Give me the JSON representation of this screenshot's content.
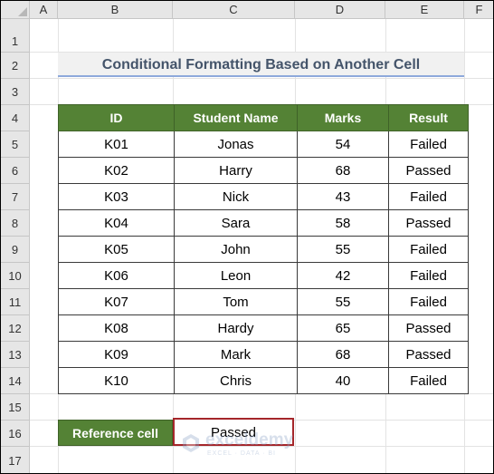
{
  "columns": [
    "A",
    "B",
    "C",
    "D",
    "E",
    "F"
  ],
  "rows": [
    "1",
    "2",
    "3",
    "4",
    "5",
    "6",
    "7",
    "8",
    "9",
    "10",
    "11",
    "12",
    "13",
    "14",
    "15",
    "16",
    "17"
  ],
  "title": "Conditional Formatting Based on Another Cell",
  "table": {
    "headers": [
      "ID",
      "Student Name",
      "Marks",
      "Result"
    ],
    "rows": [
      [
        "K01",
        "Jonas",
        "54",
        "Failed"
      ],
      [
        "K02",
        "Harry",
        "68",
        "Passed"
      ],
      [
        "K03",
        "Nick",
        "43",
        "Failed"
      ],
      [
        "K04",
        "Sara",
        "58",
        "Passed"
      ],
      [
        "K05",
        "John",
        "55",
        "Failed"
      ],
      [
        "K06",
        "Leon",
        "42",
        "Failed"
      ],
      [
        "K07",
        "Tom",
        "55",
        "Failed"
      ],
      [
        "K08",
        "Hardy",
        "65",
        "Passed"
      ],
      [
        "K09",
        "Mark",
        "68",
        "Passed"
      ],
      [
        "K10",
        "Chris",
        "40",
        "Failed"
      ]
    ]
  },
  "reference": {
    "label": "Reference cell",
    "value": "Passed"
  },
  "watermark": {
    "name": "exceldemy",
    "tagline": "EXCEL · DATA · BI"
  },
  "colors": {
    "header_green": "#548235",
    "title_text": "#44546a",
    "reference_border": "#a5262a"
  }
}
